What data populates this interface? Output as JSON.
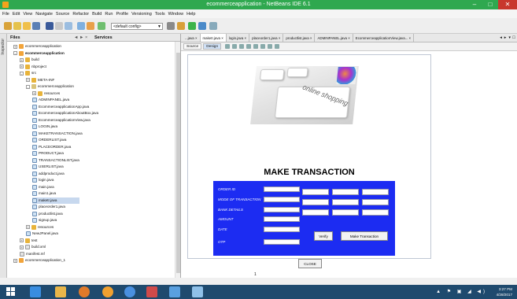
{
  "window": {
    "title": "ecommerceapplication - NetBeans IDE 6.1"
  },
  "menu": [
    "File",
    "Edit",
    "View",
    "Navigate",
    "Source",
    "Refactor",
    "Build",
    "Run",
    "Profile",
    "Versioning",
    "Tools",
    "Window",
    "Help"
  ],
  "toolbar": {
    "config_combo": "<default config>"
  },
  "side_strip": {
    "label": "Inspector"
  },
  "panel": {
    "files_tab": "Files",
    "services_tab": "Services",
    "controls": "◄ ► ×"
  },
  "tree": [
    {
      "label": "ecommerceapplication",
      "indent": 1,
      "icon": "project",
      "expander": "+"
    },
    {
      "label": "ecommerceapplication",
      "indent": 1,
      "icon": "project",
      "expander": "-",
      "bold": true
    },
    {
      "label": "build",
      "indent": 2,
      "icon": "folder",
      "expander": "+"
    },
    {
      "label": "nbproject",
      "indent": 2,
      "icon": "folder",
      "expander": "+"
    },
    {
      "label": "src",
      "indent": 2,
      "icon": "folder",
      "expander": "-"
    },
    {
      "label": "META-INF",
      "indent": 3,
      "icon": "folder",
      "expander": "+"
    },
    {
      "label": "ecommerceapplication",
      "indent": 3,
      "icon": "package",
      "expander": "-"
    },
    {
      "label": "resources",
      "indent": 4,
      "icon": "folder",
      "expander": "+"
    },
    {
      "label": "ADMINPANEL.java",
      "indent": 4,
      "icon": "java"
    },
    {
      "label": "EcommerceapplicationApp.java",
      "indent": 4,
      "icon": "java"
    },
    {
      "label": "EcommerceapplicationAboutBox.java",
      "indent": 4,
      "icon": "java"
    },
    {
      "label": "EcommerceapplicationView.java",
      "indent": 4,
      "icon": "java"
    },
    {
      "label": "LOGIN.java",
      "indent": 4,
      "icon": "java"
    },
    {
      "label": "MAKETRANSACTION.java",
      "indent": 4,
      "icon": "java"
    },
    {
      "label": "ORDERLIST.java",
      "indent": 4,
      "icon": "java"
    },
    {
      "label": "PLACEORDER.java",
      "indent": 4,
      "icon": "java"
    },
    {
      "label": "PRODUCT.java",
      "indent": 4,
      "icon": "java"
    },
    {
      "label": "TRANSACTIONLIST.java",
      "indent": 4,
      "icon": "java"
    },
    {
      "label": "USERLIST.java",
      "indent": 4,
      "icon": "java"
    },
    {
      "label": "addproduct.java",
      "indent": 4,
      "icon": "java"
    },
    {
      "label": "login.java",
      "indent": 4,
      "icon": "java"
    },
    {
      "label": "main.java",
      "indent": 4,
      "icon": "java"
    },
    {
      "label": "main1.java",
      "indent": 4,
      "icon": "java"
    },
    {
      "label": "maketr.java",
      "indent": 4,
      "icon": "java",
      "selected": true
    },
    {
      "label": "placeorder1.java",
      "indent": 4,
      "icon": "java"
    },
    {
      "label": "productlist.java",
      "indent": 4,
      "icon": "java"
    },
    {
      "label": "signup.java",
      "indent": 4,
      "icon": "java"
    },
    {
      "label": "resources",
      "indent": 3,
      "icon": "folder",
      "expander": "+"
    },
    {
      "label": "NewJPanel.java",
      "indent": 3,
      "icon": "java"
    },
    {
      "label": "test",
      "indent": 2,
      "icon": "folder",
      "expander": "+"
    },
    {
      "label": "build.xml",
      "indent": 2,
      "icon": "file",
      "expander": "+"
    },
    {
      "label": "manifest.mf",
      "indent": 2,
      "icon": "file"
    },
    {
      "label": "ecommerceapplication_1",
      "indent": 1,
      "icon": "project",
      "expander": "+"
    }
  ],
  "editor_tabs": [
    {
      "label": "...java",
      "active": false
    },
    {
      "label": "maketr.java",
      "active": true
    },
    {
      "label": "login.java",
      "active": false
    },
    {
      "label": "placeorder1.java",
      "active": false
    },
    {
      "label": "productlist.java",
      "active": false
    },
    {
      "label": "ADMINPANEL.java",
      "active": false
    },
    {
      "label": "EcommerceapplicationView.java...",
      "active": false
    }
  ],
  "editor_nav": "◄ ► ▼ ☐",
  "subbar": {
    "source": "Source",
    "design": "Design"
  },
  "form": {
    "hero_text": "online shopping",
    "heading": "MAKE TRANSACTION",
    "labels": [
      "ORDER ID",
      "MODE OF TRANSACTION",
      "BANK DETAILS",
      "AMOUNT",
      "DATE",
      "OTP"
    ],
    "verify_label": "Verify",
    "make_transaction_label": "Make Transaction",
    "close_label": "CLOSE",
    "page_number": "1"
  },
  "tray": {
    "time": "3:27 PM",
    "date": "4/28/2017",
    "icons": "▲ ⚑ ▣ ◢ ◀)"
  },
  "colors": {
    "titlebar": "#2fa84f",
    "form_panel": "#1c2cf2",
    "taskbar": "#1f4a6e"
  }
}
